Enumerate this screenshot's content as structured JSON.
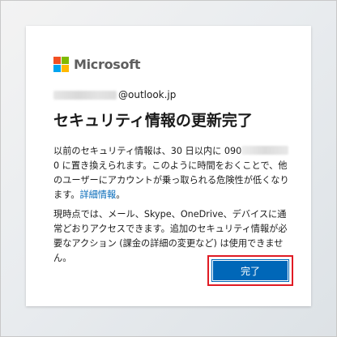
{
  "brand": {
    "name": "Microsoft",
    "colors": [
      "#f25022",
      "#7fba00",
      "#00a4ef",
      "#ffb900"
    ]
  },
  "account": {
    "email_visible_part": "@outlook.jp"
  },
  "heading": "セキュリティ情報の更新完了",
  "message1": {
    "before_redact": "以前のセキュリティ情報は、30 日以内に 090",
    "after_redact": "0 に置き換えられます。このように時間をおくことで、他のユーザーにアカウントが乗っ取られる危険性が低くなります。",
    "link": "詳細情報",
    "end": "。"
  },
  "message2": "現時点では、メール、Skype、OneDrive、デバイスに通常どおりアクセスできます。追加のセキュリティ情報が必要なアクション (課金の詳細の変更など) は使用できません。",
  "buttons": {
    "done": "完了"
  },
  "colors": {
    "accent": "#0067b8",
    "highlight_border": "#e01b24"
  }
}
